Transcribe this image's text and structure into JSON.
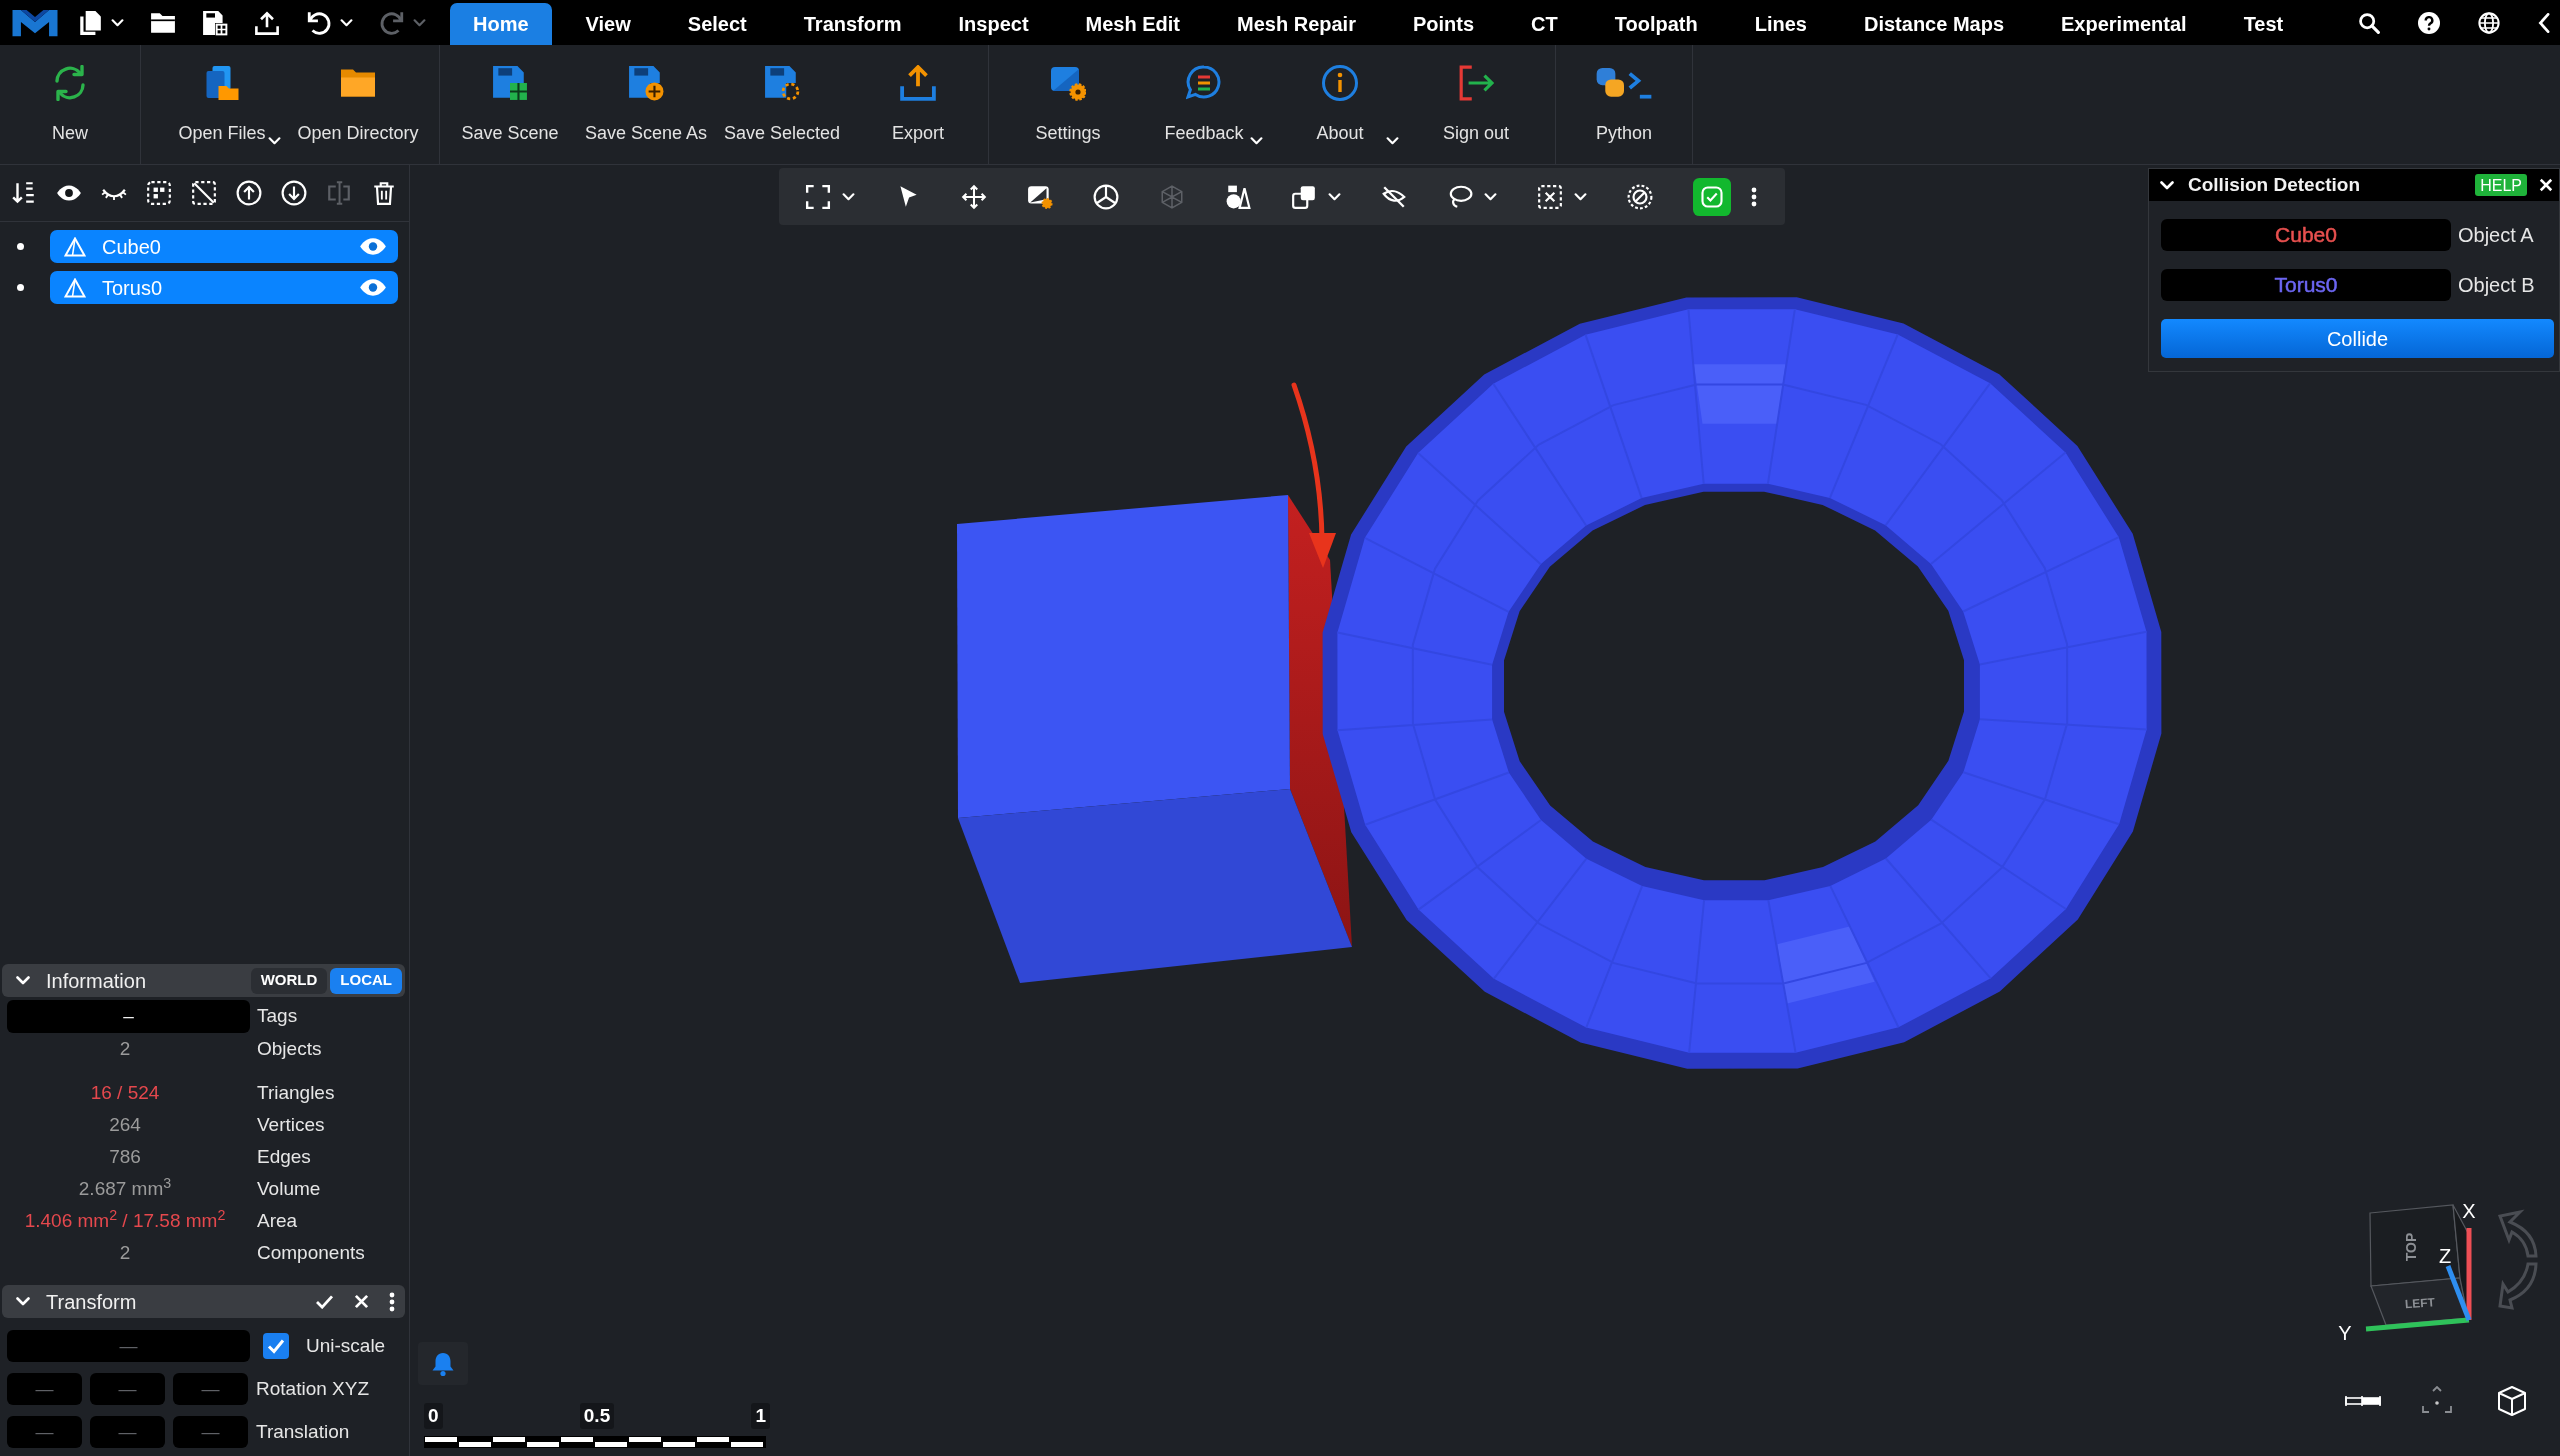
{
  "menu_bar": {
    "quick_actions": [
      {
        "dropdown": true,
        "disabled": false
      },
      {
        "dropdown": false,
        "disabled": false
      },
      {
        "dropdown": false,
        "disabled": false
      },
      {
        "dropdown": false,
        "disabled": false
      },
      {
        "dropdown": true,
        "disabled": false
      },
      {
        "dropdown": true,
        "disabled": true
      }
    ],
    "tabs": [
      {
        "label": "Home",
        "selected": true
      },
      {
        "label": "View",
        "selected": false
      },
      {
        "label": "Select",
        "selected": false
      },
      {
        "label": "Transform",
        "selected": false
      },
      {
        "label": "Inspect",
        "selected": false
      },
      {
        "label": "Mesh Edit",
        "selected": false
      },
      {
        "label": "Mesh Repair",
        "selected": false
      },
      {
        "label": "Points",
        "selected": false
      },
      {
        "label": "CT",
        "selected": false
      },
      {
        "label": "Toolpath",
        "selected": false
      },
      {
        "label": "Lines",
        "selected": false
      },
      {
        "label": "Distance Maps",
        "selected": false
      },
      {
        "label": "Experimental",
        "selected": false
      },
      {
        "label": "Test",
        "selected": false
      }
    ]
  },
  "ribbon": {
    "groups": [
      {
        "buttons": [
          {
            "label": "New",
            "dropdown": false
          }
        ]
      },
      {
        "buttons": [
          {
            "label": "Open Files",
            "dropdown": true
          },
          {
            "label": "Open Directory",
            "dropdown": false
          }
        ]
      },
      {
        "buttons": [
          {
            "label": "Save Scene",
            "dropdown": false
          },
          {
            "label": "Save Scene As",
            "dropdown": false
          },
          {
            "label": "Save Selected",
            "dropdown": false
          },
          {
            "label": "Export",
            "dropdown": false
          }
        ]
      },
      {
        "buttons": [
          {
            "label": "Settings",
            "dropdown": false
          },
          {
            "label": "Feedback",
            "dropdown": true
          },
          {
            "label": "About",
            "dropdown": true
          },
          {
            "label": "Sign out",
            "dropdown": false
          }
        ]
      },
      {
        "buttons": [
          {
            "label": "Python",
            "dropdown": false
          }
        ]
      }
    ]
  },
  "scene_panel": {
    "toolbar": [
      {
        "disabled": false
      },
      {
        "disabled": false
      },
      {
        "disabled": false
      },
      {
        "disabled": false
      },
      {
        "disabled": false
      },
      {
        "disabled": false
      },
      {
        "disabled": false
      },
      {
        "disabled": true
      },
      {
        "disabled": false
      }
    ],
    "objects": [
      {
        "name": "Cube0",
        "selected": true,
        "visible": true
      },
      {
        "name": "Torus0",
        "selected": true,
        "visible": true
      }
    ]
  },
  "information": {
    "title": "Information",
    "expanded": true,
    "modes": [
      {
        "label": "WORLD",
        "selected": false
      },
      {
        "label": "LOCAL",
        "selected": true
      }
    ],
    "rows": [
      {
        "kind": "field",
        "value": "–",
        "label": "Tags",
        "warning": false
      },
      {
        "kind": "text",
        "value": "2",
        "label": "Objects",
        "warning": false
      },
      {
        "kind": "text",
        "value": "16 / 524",
        "label": "Triangles",
        "warning": true
      },
      {
        "kind": "text",
        "value": "264",
        "label": "Vertices",
        "warning": false
      },
      {
        "kind": "text",
        "value": "786",
        "label": "Edges",
        "warning": false
      },
      {
        "kind": "text",
        "value": "2.687 mm$^{3}$",
        "label": "Volume",
        "warning": false
      },
      {
        "kind": "text",
        "value": "1.406 mm$^{2}$ / 17.58 mm$^{2}$",
        "label": "Area",
        "warning": true
      },
      {
        "kind": "text",
        "value": "2",
        "label": "Components",
        "warning": false
      }
    ]
  },
  "transform": {
    "title": "Transform",
    "expanded": true,
    "rows": [
      {
        "kind": "scale",
        "fields": [
          "—"
        ],
        "checked": true,
        "label": "Uni-scale"
      },
      {
        "kind": "vector",
        "fields": [
          "—",
          "—",
          "—"
        ],
        "label": "Rotation XYZ"
      },
      {
        "kind": "vector",
        "fields": [
          "—",
          "—",
          "—"
        ],
        "label": "Translation"
      }
    ]
  },
  "viewport": {
    "toolbar": [
      {
        "dropdown": true,
        "on": false,
        "disabled": false
      },
      {
        "dropdown": false,
        "on": false,
        "disabled": false
      },
      {
        "dropdown": false,
        "on": false,
        "disabled": false
      },
      {
        "dropdown": false,
        "on": false,
        "disabled": false
      },
      {
        "dropdown": false,
        "on": false,
        "disabled": false
      },
      {
        "dropdown": false,
        "on": false,
        "disabled": true
      },
      {
        "dropdown": false,
        "on": false,
        "disabled": false
      },
      {
        "dropdown": true,
        "on": false,
        "disabled": false
      },
      {
        "dropdown": false,
        "on": false,
        "disabled": false
      },
      {
        "dropdown": true,
        "on": false,
        "disabled": false
      },
      {
        "dropdown": true,
        "on": false,
        "disabled": false
      },
      {
        "dropdown": false,
        "on": false,
        "disabled": false
      },
      {
        "dropdown": false,
        "on": true,
        "disabled": false
      }
    ],
    "scale_bar": {
      "labels": [
        "0",
        "0.5",
        "1"
      ]
    },
    "view_cube": {
      "faces": [
        "TOP",
        "LEFT"
      ],
      "axes": [
        {
          "label": "X",
          "color": "#ee4f55"
        },
        {
          "label": "Y",
          "color": "#2fc25a"
        },
        {
          "label": "Z",
          "color": "#2e8ef0"
        }
      ]
    }
  },
  "collision_panel": {
    "title": "Collision Detection",
    "expanded": true,
    "help": "HELP",
    "objects": [
      {
        "value": "Cube0",
        "label": "Object A",
        "color": "#e8504f"
      },
      {
        "value": "Torus0",
        "label": "Object B",
        "color": "#6c66f2"
      }
    ],
    "button": "Collide"
  }
}
